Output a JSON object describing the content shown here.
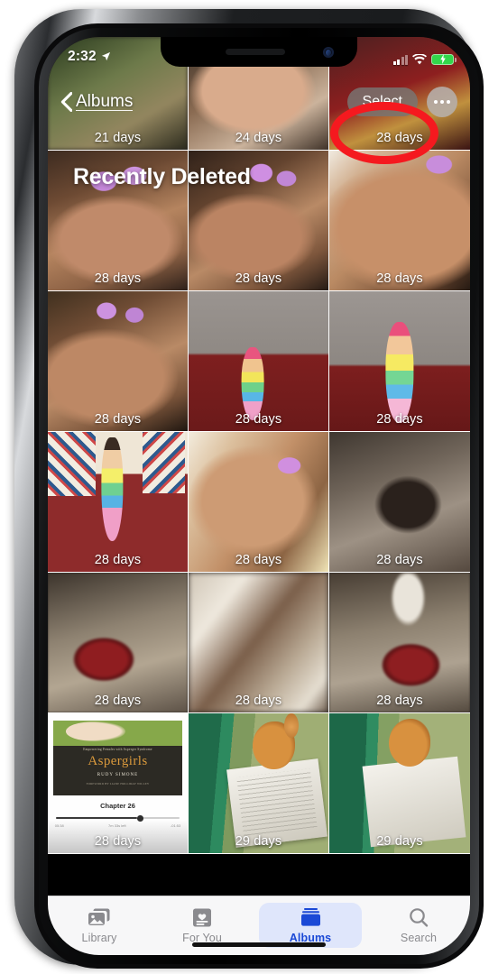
{
  "status_bar": {
    "time": "2:32",
    "location_icon": "location-arrow-icon",
    "cellular_icon": "signal-bars-icon",
    "wifi_icon": "wifi-icon",
    "battery_icon": "battery-charging-icon",
    "battery_color": "#32d74b"
  },
  "nav": {
    "back_label": "Albums",
    "back_icon": "chevron-left-icon",
    "select_label": "Select",
    "more_icon": "ellipsis-icon"
  },
  "page": {
    "title": "Recently Deleted"
  },
  "annotation": {
    "shape": "ellipse",
    "color": "#f5191f",
    "targets": "Select"
  },
  "peek_row": {
    "items": [
      {
        "days": "21 days"
      },
      {
        "days": "24 days"
      },
      {
        "days": "28 days"
      }
    ]
  },
  "grid": {
    "rows": [
      [
        {
          "days": "28 days",
          "art": "art-girl",
          "alt": "girl-with-flower-clips"
        },
        {
          "days": "28 days",
          "art": "art-girl2",
          "alt": "girl-with-flower-clips"
        },
        {
          "days": "28 days",
          "art": "art-girl3",
          "alt": "girl-closeup"
        }
      ],
      [
        {
          "days": "28 days",
          "art": "art-girl4",
          "alt": "girl-with-flower-clips"
        },
        {
          "days": "28 days",
          "art": "art-doll",
          "alt": "rainbow-mermaid-doll"
        },
        {
          "days": "28 days",
          "art": "art-doll2",
          "alt": "rainbow-mermaid-doll"
        }
      ],
      [
        {
          "days": "28 days",
          "art": "art-doll3",
          "alt": "doll-held-in-hand"
        },
        {
          "days": "28 days",
          "art": "art-girl5",
          "alt": "girl-eyes-closed"
        },
        {
          "days": "28 days",
          "art": "art-rabbit",
          "alt": "black-rabbit"
        }
      ],
      [
        {
          "days": "28 days",
          "art": "art-bowl",
          "alt": "red-bowl-blurred"
        },
        {
          "days": "28 days",
          "art": "art-blur",
          "alt": "motion-blur-photo"
        },
        {
          "days": "28 days",
          "art": "art-bowl2",
          "alt": "red-bowl-blurred"
        }
      ],
      [
        {
          "days": "28 days",
          "art": "art-book",
          "alt": "audiobook-screenshot"
        },
        {
          "days": "29 days",
          "art": "art-chicken",
          "alt": "chicken-and-paper"
        },
        {
          "days": "29 days",
          "art": "art-chicken2",
          "alt": "chicken-and-paper"
        }
      ]
    ]
  },
  "audiobook": {
    "tagline": "Empowering Females with Asperger Syndrome",
    "title": "Aspergirls",
    "author": "RUDY SIMONE",
    "foreword": "FOREWORD BY LIANE HOLLIDAY WILLEY",
    "chapter": "Chapter 26",
    "elapsed": "05:38",
    "remaining": "7m 33s left",
    "total": "-01:53"
  },
  "tab_bar": {
    "tabs": [
      {
        "label": "Library",
        "icon": "photos-library-icon",
        "active": false
      },
      {
        "label": "For You",
        "icon": "for-you-heart-icon",
        "active": false
      },
      {
        "label": "Albums",
        "icon": "albums-folder-icon",
        "active": true
      },
      {
        "label": "Search",
        "icon": "magnifier-icon",
        "active": false
      }
    ],
    "active_color": "#1b49d6",
    "active_bg": "#dfe6fb"
  }
}
